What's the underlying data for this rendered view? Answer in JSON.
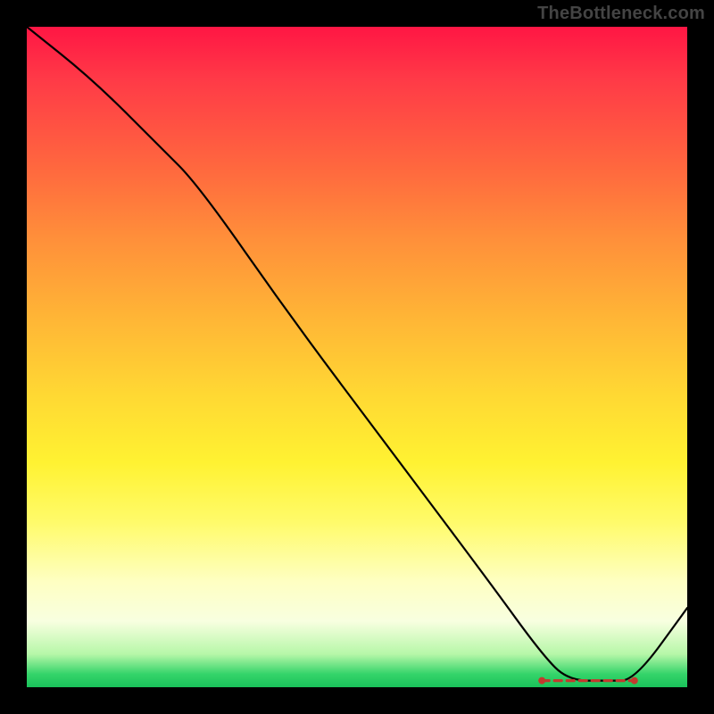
{
  "watermark": "TheBottleneck.com",
  "chart_data": {
    "type": "line",
    "title": "",
    "xlabel": "",
    "ylabel": "",
    "xlim": [
      0,
      100
    ],
    "ylim": [
      0,
      100
    ],
    "series": [
      {
        "name": "curve",
        "x": [
          0,
          10,
          20,
          26,
          40,
          55,
          70,
          78,
          82,
          88,
          92,
          100
        ],
        "y": [
          100,
          92,
          82,
          76,
          56,
          36,
          16,
          5,
          1,
          1,
          1,
          12
        ]
      }
    ],
    "flat_region": {
      "x_start": 78,
      "x_end": 92,
      "y": 1
    },
    "background_gradient": {
      "stops": [
        {
          "pos": 0.0,
          "color": "#ff1644"
        },
        {
          "pos": 0.32,
          "color": "#ff8f3a"
        },
        {
          "pos": 0.6,
          "color": "#ffe733"
        },
        {
          "pos": 0.85,
          "color": "#fdffd0"
        },
        {
          "pos": 1.0,
          "color": "#19c25a"
        }
      ]
    }
  }
}
